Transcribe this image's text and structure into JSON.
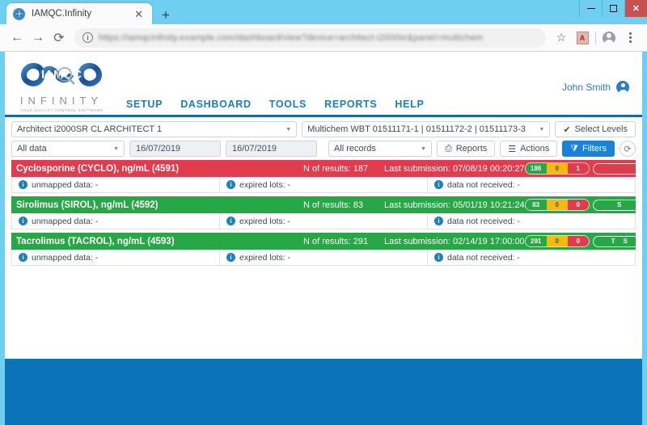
{
  "browser": {
    "tab_title": "IAMQC.Infinity",
    "tab_close": "✕",
    "new_tab": "+",
    "back_icon": "←",
    "forward_icon": "→",
    "reload_icon": "⟳",
    "url_text": "https://iamqcinfinity.example.com/dashboard/view?device=architect-i2000sr&panel=multichem",
    "info_icon": "i",
    "star_icon": "☆",
    "pdf_icon": "A",
    "minimize": "—",
    "maximize": "□",
    "close": "✕"
  },
  "header": {
    "logo_main": "IAMQC",
    "logo_sub": "INFINITY",
    "logo_tagline": "YOUR QUALITY CONTROL SOFTWARE",
    "user_name": "John Smith",
    "nav": [
      {
        "label": "SETUP"
      },
      {
        "label": "DASHBOARD"
      },
      {
        "label": "TOOLS"
      },
      {
        "label": "REPORTS"
      },
      {
        "label": "HELP"
      }
    ]
  },
  "filters": {
    "device_select": "Architect i2000SR CL ARCHITECT 1",
    "lot_select": "Multichem WBT 01511171-1 | 01511172-2 | 01511173-3",
    "select_levels_label": "Select Levels",
    "select_levels_icon": "✔",
    "data_range_select": "All data",
    "date_from": "16/07/2019",
    "date_to": "16/07/2019",
    "records_select": "All records",
    "reports_label": "Reports",
    "reports_icon": "⎙",
    "actions_label": "Actions",
    "actions_icon": "☰",
    "filters_label": "Filters",
    "filters_icon": "⧩",
    "refresh_icon": "⟳",
    "caret": "▼"
  },
  "tests": [
    {
      "name": "Cyclosporine (CYCLO), ng/mL (4591)",
      "n_results": "N of results: 187",
      "last_submission": "Last submission: 07/08/19 00:20:27",
      "status": "red",
      "badge_green": "186",
      "badge_yellow": "0",
      "badge_red": "1",
      "pills": [],
      "chevron": "⌄",
      "unmapped": "unmapped data: -",
      "expired": "expired lots: -",
      "not_received": "data not received: -"
    },
    {
      "name": "Sirolimus (SIROL), ng/mL (4592)",
      "n_results": "N of results: 83",
      "last_submission": "Last submission: 05/01/19 10:21:24",
      "status": "green",
      "badge_green": "83",
      "badge_yellow": "0",
      "badge_red": "0",
      "pills": [
        "S"
      ],
      "chevron": "⌄",
      "unmapped": "unmapped data: -",
      "expired": "expired lots: -",
      "not_received": "data not received: -"
    },
    {
      "name": "Tacrolimus (TACROL), ng/mL (4593)",
      "n_results": "N of results: 291",
      "last_submission": "Last submission: 02/14/19 17:00:00",
      "status": "green",
      "badge_green": "291",
      "badge_yellow": "0",
      "badge_red": "0",
      "pills": [
        "T",
        "S"
      ],
      "chevron": "⌄",
      "unmapped": "unmapped data: -",
      "expired": "expired lots: -",
      "not_received": "data not received: -"
    }
  ],
  "info_icon_glyph": "i",
  "colors": {
    "brand_blue": "#1668ad",
    "accent_blue": "#1a82d8",
    "status_red": "#e03c4d",
    "status_green": "#27a745",
    "status_yellow": "#f5b912",
    "footer_blue": "#0b73b8",
    "chrome_blue": "#6ecff0"
  }
}
